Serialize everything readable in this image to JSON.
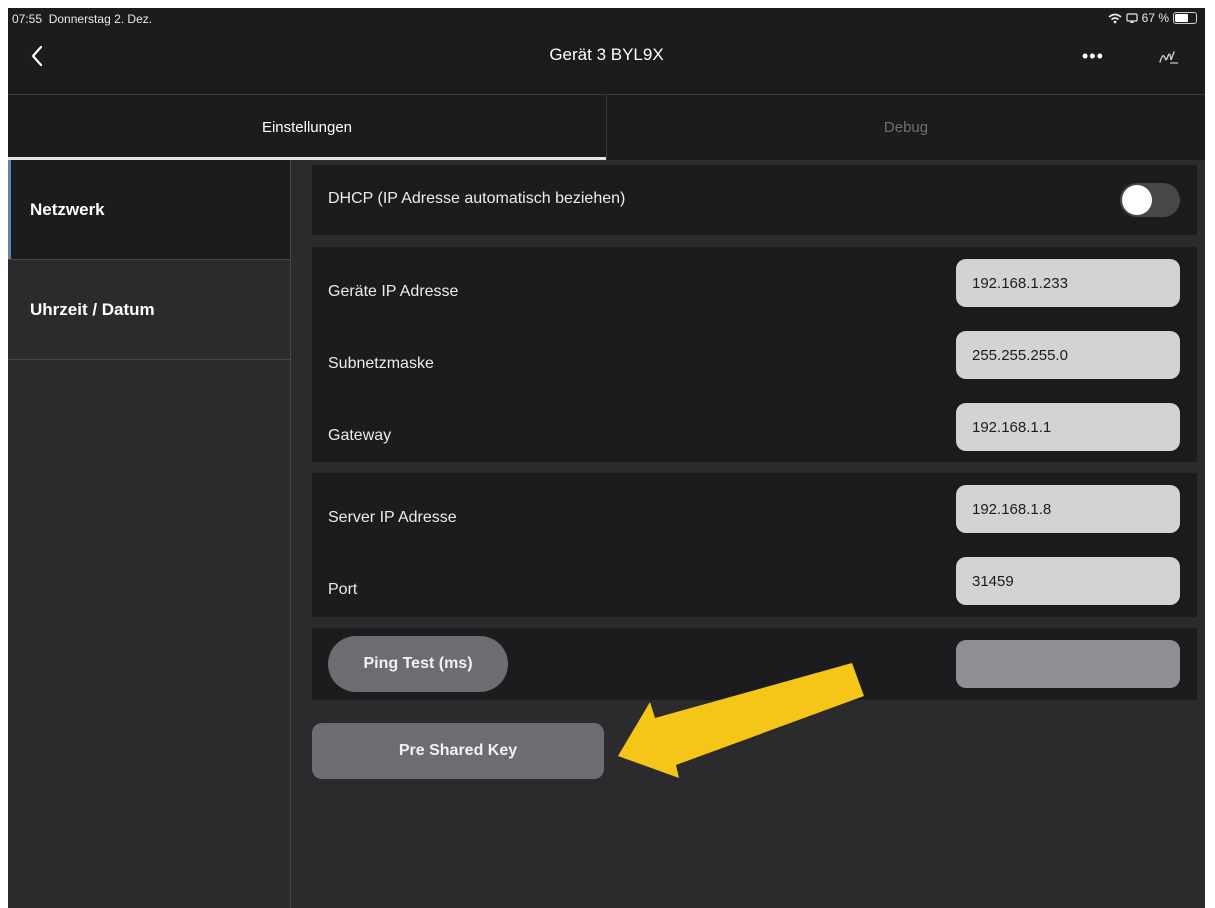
{
  "status_bar": {
    "time": "07:55",
    "date": "Donnerstag 2. Dez.",
    "battery": "67 %"
  },
  "nav": {
    "title": "Gerät 3 BYL9X",
    "more": "•••"
  },
  "tabs": [
    {
      "label": "Einstellungen",
      "active": true
    },
    {
      "label": "Debug",
      "active": false
    }
  ],
  "sidebar": {
    "items": [
      {
        "label": "Netzwerk",
        "active": true
      },
      {
        "label": "Uhrzeit / Datum",
        "active": false
      }
    ]
  },
  "dhcp": {
    "label": "DHCP (IP Adresse automatisch beziehen)",
    "enabled": false
  },
  "network": {
    "device_ip_label": "Geräte IP Adresse",
    "device_ip_value": "192.168.1.233",
    "subnet_label": "Subnetzmaske",
    "subnet_value": "255.255.255.0",
    "gateway_label": "Gateway",
    "gateway_value": "192.168.1.1"
  },
  "server": {
    "ip_label": "Server IP Adresse",
    "ip_value": "192.168.1.8",
    "port_label": "Port",
    "port_value": "31459"
  },
  "ping": {
    "button_label": "Ping Test (ms)",
    "result": ""
  },
  "psk": {
    "button_label": "Pre Shared Key"
  },
  "colors": {
    "background": "#2b2b2d",
    "panel": "#1c1c1e",
    "field": "#d3d3d5",
    "button": "#6d6d71",
    "accent_indicator": "#5a86a8",
    "annotation_arrow": "#f5c518"
  }
}
